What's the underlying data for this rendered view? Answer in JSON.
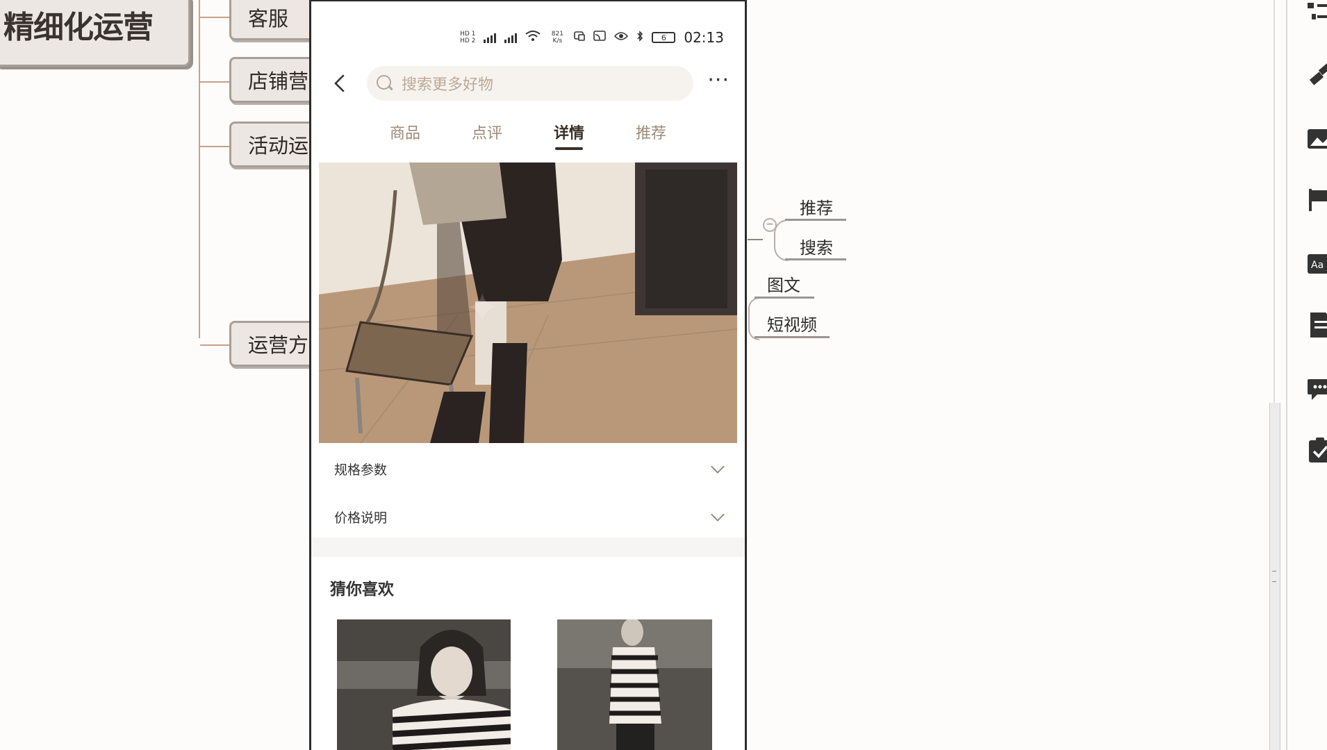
{
  "mindmap": {
    "root_label": "精细化运营",
    "branches": [
      {
        "label": "客服"
      },
      {
        "label": "店铺营"
      },
      {
        "label": "活动运"
      },
      {
        "label": "运营方"
      }
    ],
    "sub_nodes": [
      {
        "label": "推荐"
      },
      {
        "label": "搜索"
      },
      {
        "label": "图文"
      },
      {
        "label": "短视频"
      }
    ],
    "collapse_symbol": "−"
  },
  "phone": {
    "status": {
      "hd1": "HD 1",
      "hd2": "HD 2",
      "net_speed": "821 K/s",
      "battery": "6",
      "time": "02:13"
    },
    "search": {
      "placeholder": "搜索更多好物"
    },
    "more_label": "···",
    "back_label": "‹",
    "tabs": [
      {
        "label": "商品",
        "active": false
      },
      {
        "label": "点评",
        "active": false
      },
      {
        "label": "详情",
        "active": true
      },
      {
        "label": "推荐",
        "active": false
      }
    ],
    "spec_rows": [
      {
        "label": "规格参数"
      },
      {
        "label": "价格说明"
      }
    ],
    "guess_title": "猜你喜欢",
    "accent_color": "#3a3026",
    "muted_color": "#9c8a78"
  },
  "toolbar": {
    "icons": [
      "list-tree-icon",
      "hammer-icon",
      "image-icon",
      "flag-icon",
      "text-style-icon",
      "document-icon",
      "comment-icon",
      "task-icon"
    ],
    "text_style_glyph": "Aa"
  }
}
